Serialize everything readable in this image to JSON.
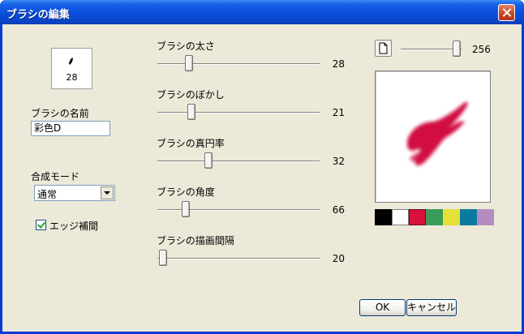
{
  "window": {
    "title": "ブラシの編集",
    "close_label": "×"
  },
  "preview": {
    "size": "28"
  },
  "name": {
    "label": "ブラシの名前",
    "value": "彩色D"
  },
  "blend": {
    "label": "合成モード",
    "value": "通常"
  },
  "interp": {
    "label": "エッジ補間",
    "checked": true
  },
  "sliders": [
    {
      "label": "ブラシの太さ",
      "value": "28"
    },
    {
      "label": "ブラシのぼかし",
      "value": "21"
    },
    {
      "label": "ブラシの真円率",
      "value": "32"
    },
    {
      "label": "ブラシの角度",
      "value": "66"
    },
    {
      "label": "ブラシの描画間隔",
      "value": "20"
    }
  ],
  "texture": {
    "value": "256"
  },
  "palette": [
    "#000000",
    "#ffffff",
    "#d8103c",
    "#3a9a58",
    "#e6e03a",
    "#0a7aa0",
    "#b58cc0"
  ],
  "buttons": {
    "ok": "OK",
    "cancel": "キャンセル"
  }
}
